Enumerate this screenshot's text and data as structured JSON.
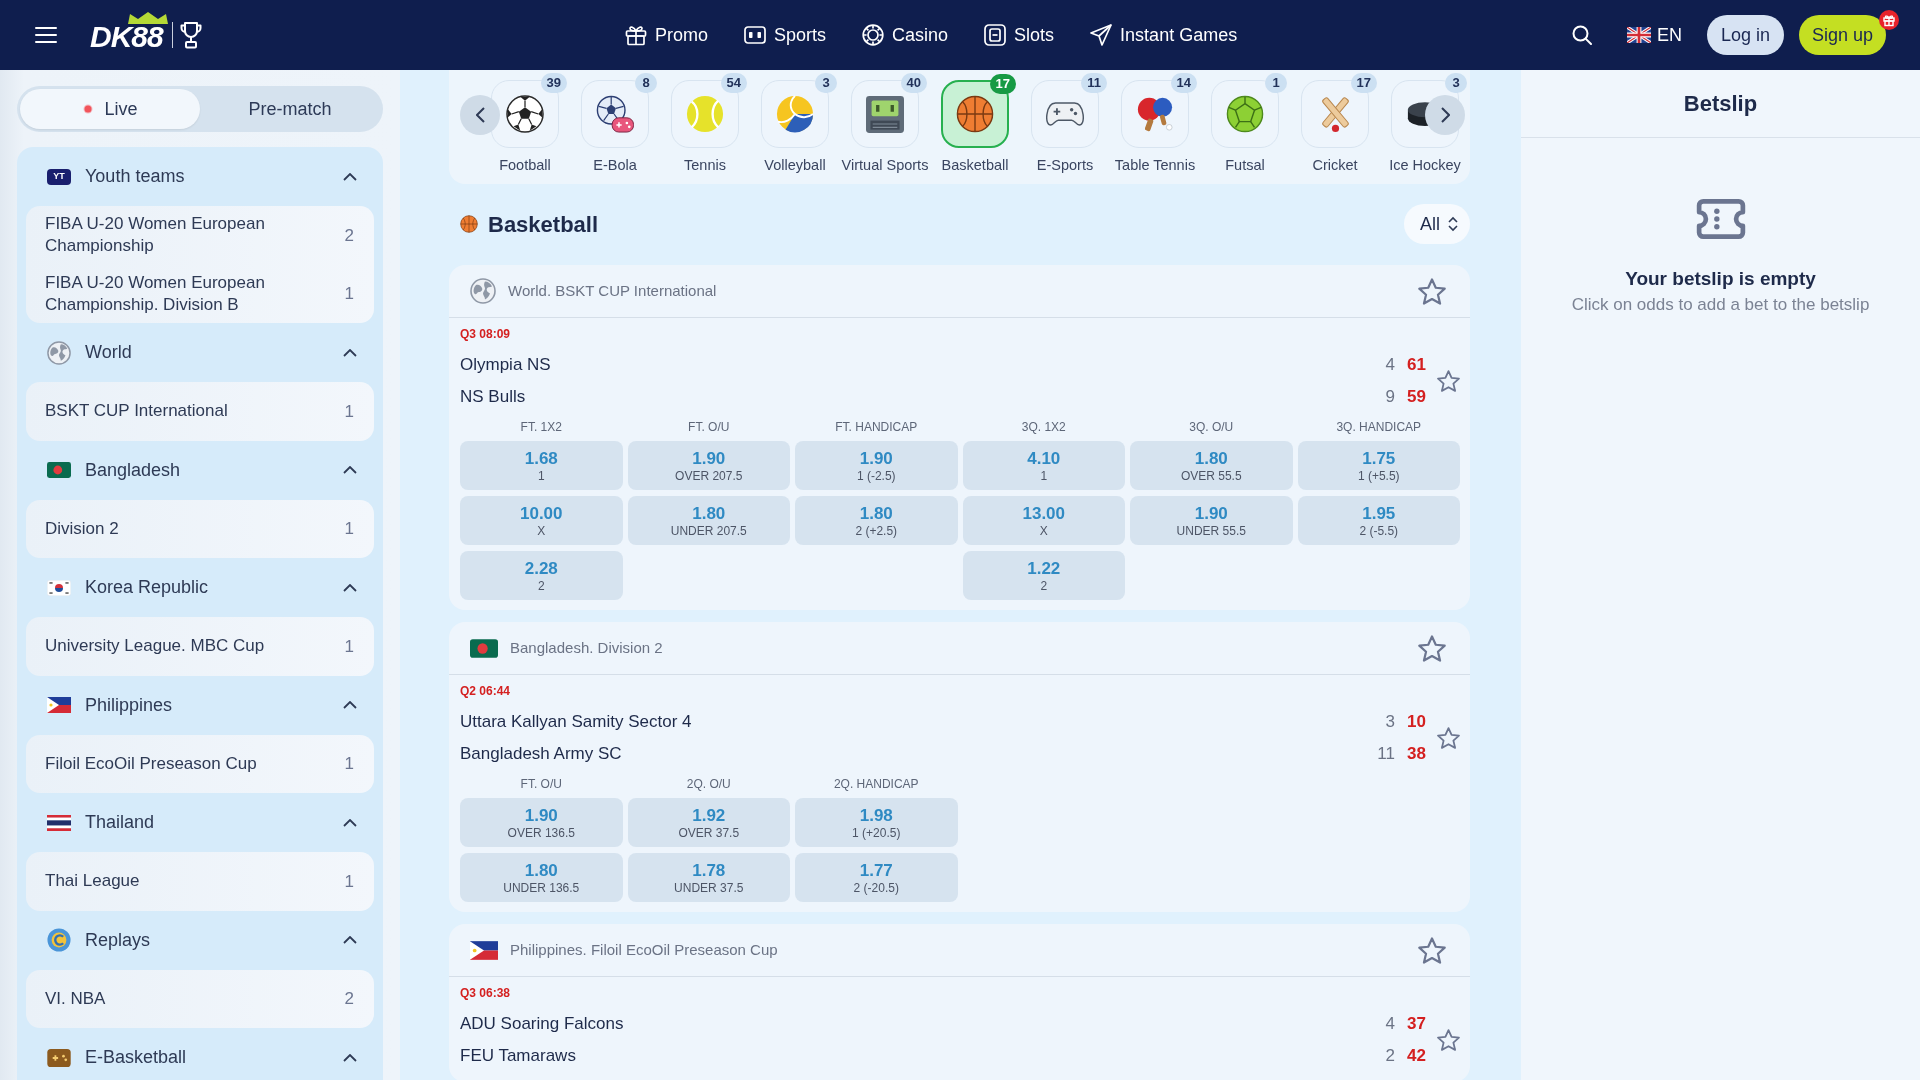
{
  "header": {
    "logo": "DK88",
    "nav": [
      {
        "label": "Promo",
        "kind": "promo"
      },
      {
        "label": "Sports",
        "kind": "sports"
      },
      {
        "label": "Casino",
        "kind": "casino"
      },
      {
        "label": "Slots",
        "kind": "slots"
      },
      {
        "label": "Instant Games",
        "kind": "instant"
      }
    ],
    "language": "EN",
    "login": "Log in",
    "signup": "Sign up"
  },
  "sidebar": {
    "modes": [
      {
        "label": "Live",
        "kind": "live",
        "selected": true
      },
      {
        "label": "Pre-match",
        "kind": "prematch",
        "selected": false
      }
    ],
    "groups": [
      {
        "name": "Youth teams",
        "kind": "youth",
        "logo_text": "YT",
        "expanded": true,
        "items": [
          {
            "name": "FIBA U-20 Women European Championship",
            "count": "2"
          },
          {
            "name": "FIBA U-20 Women European Championship. Division B",
            "count": "1"
          }
        ]
      },
      {
        "name": "World",
        "kind": "world",
        "expanded": true,
        "items": [
          {
            "name": "BSKT CUP International",
            "count": "1"
          }
        ]
      },
      {
        "name": "Bangladesh",
        "kind": "bangladesh",
        "expanded": true,
        "items": [
          {
            "name": "Division 2",
            "count": "1"
          }
        ]
      },
      {
        "name": "Korea Republic",
        "kind": "korea",
        "expanded": true,
        "items": [
          {
            "name": "University League. MBC Cup",
            "count": "1"
          }
        ]
      },
      {
        "name": "Philippines",
        "kind": "philippines",
        "expanded": true,
        "items": [
          {
            "name": "Filoil EcoOil Preseason Cup",
            "count": "1"
          }
        ]
      },
      {
        "name": "Thailand",
        "kind": "thailand",
        "expanded": true,
        "items": [
          {
            "name": "Thai League",
            "count": "1"
          }
        ]
      },
      {
        "name": "Replays",
        "kind": "replays",
        "expanded": true,
        "items": [
          {
            "name": "VI. NBA",
            "count": "2"
          }
        ]
      },
      {
        "name": "E-Basketball",
        "kind": "ebasketball",
        "expanded": true
      }
    ]
  },
  "sports": [
    {
      "label": "Football",
      "count": "39",
      "kind": "football",
      "selected": false
    },
    {
      "label": "E-Bola",
      "count": "8",
      "kind": "ebola",
      "selected": false
    },
    {
      "label": "Tennis",
      "count": "54",
      "kind": "tennis",
      "selected": false
    },
    {
      "label": "Volleyball",
      "count": "3",
      "kind": "volleyball",
      "selected": false
    },
    {
      "label": "Virtual Sports",
      "count": "40",
      "kind": "virtual",
      "selected": false
    },
    {
      "label": "Basketball",
      "count": "17",
      "kind": "basketball",
      "selected": true
    },
    {
      "label": "E-Sports",
      "count": "11",
      "kind": "esports",
      "selected": false
    },
    {
      "label": "Table Tennis",
      "count": "14",
      "kind": "tabletennis",
      "selected": false
    },
    {
      "label": "Futsal",
      "count": "1",
      "kind": "futsal",
      "selected": false
    },
    {
      "label": "Cricket",
      "count": "17",
      "kind": "cricket",
      "selected": false
    },
    {
      "label": "Ice Hockey",
      "count": "3",
      "kind": "hockey",
      "selected": false
    }
  ],
  "section": {
    "title": "Basketball",
    "filter": "All"
  },
  "matches": [
    {
      "league": "World. BSKT CUP International",
      "kind": "world",
      "time": "Q3 08:09",
      "teams": [
        {
          "name": "Olympia NS",
          "period": "4",
          "total": "61"
        },
        {
          "name": "NS Bulls",
          "period": "9",
          "total": "59"
        }
      ],
      "markets": [
        {
          "title": "FT. 1X2",
          "odds": [
            {
              "value": "1.68",
              "label": "1"
            },
            {
              "value": "10.00",
              "label": "X"
            },
            {
              "value": "2.28",
              "label": "2"
            }
          ]
        },
        {
          "title": "FT. O/U",
          "odds": [
            {
              "value": "1.90",
              "label": "OVER 207.5"
            },
            {
              "value": "1.80",
              "label": "UNDER 207.5"
            }
          ]
        },
        {
          "title": "FT. HANDICAP",
          "odds": [
            {
              "value": "1.90",
              "label": "1 (-2.5)"
            },
            {
              "value": "1.80",
              "label": "2 (+2.5)"
            }
          ]
        },
        {
          "title": "3Q. 1X2",
          "odds": [
            {
              "value": "4.10",
              "label": "1"
            },
            {
              "value": "13.00",
              "label": "X"
            },
            {
              "value": "1.22",
              "label": "2"
            }
          ]
        },
        {
          "title": "3Q. O/U",
          "odds": [
            {
              "value": "1.80",
              "label": "OVER 55.5"
            },
            {
              "value": "1.90",
              "label": "UNDER 55.5"
            }
          ]
        },
        {
          "title": "3Q. HANDICAP",
          "odds": [
            {
              "value": "1.75",
              "label": "1 (+5.5)"
            },
            {
              "value": "1.95",
              "label": "2 (-5.5)"
            }
          ]
        }
      ]
    },
    {
      "league": "Bangladesh. Division 2",
      "kind": "bangladesh",
      "time": "Q2 06:44",
      "teams": [
        {
          "name": "Uttara Kallyan Samity Sector 4",
          "period": "3",
          "total": "10"
        },
        {
          "name": "Bangladesh Army SC",
          "period": "11",
          "total": "38"
        }
      ],
      "markets": [
        {
          "title": "FT. O/U",
          "odds": [
            {
              "value": "1.90",
              "label": "OVER 136.5"
            },
            {
              "value": "1.80",
              "label": "UNDER 136.5"
            }
          ]
        },
        {
          "title": "2Q. O/U",
          "odds": [
            {
              "value": "1.92",
              "label": "OVER 37.5"
            },
            {
              "value": "1.78",
              "label": "UNDER 37.5"
            }
          ]
        },
        {
          "title": "2Q. HANDICAP",
          "odds": [
            {
              "value": "1.98",
              "label": "1 (+20.5)"
            },
            {
              "value": "1.77",
              "label": "2 (-20.5)"
            }
          ]
        }
      ]
    },
    {
      "league": "Philippines. Filoil EcoOil Preseason Cup",
      "kind": "philippines",
      "time": "Q3 06:38",
      "teams": [
        {
          "name": "ADU Soaring Falcons",
          "period": "4",
          "total": "37"
        },
        {
          "name": "FEU Tamaraws",
          "period": "2",
          "total": "42"
        }
      ]
    }
  ],
  "betslip": {
    "title": "Betslip",
    "message": "Your betslip is empty",
    "hint": "Click on odds to add a bet to the betslip"
  }
}
